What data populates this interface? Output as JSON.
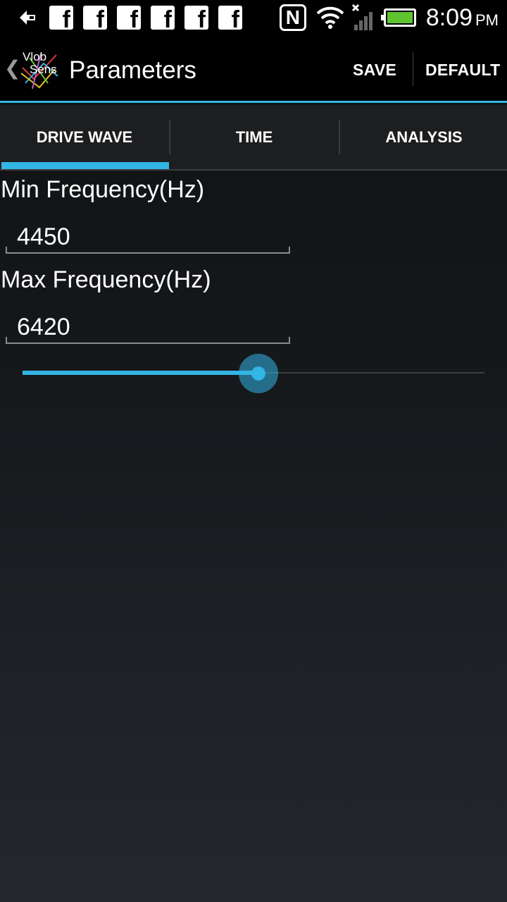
{
  "status_bar": {
    "time": "8:09",
    "ampm": "PM",
    "icons": [
      "usb-debug-icon",
      "facebook-icon",
      "facebook-icon",
      "facebook-icon",
      "facebook-icon",
      "facebook-icon",
      "facebook-icon",
      "nfc-icon",
      "wifi-icon",
      "signal-icon",
      "battery-icon"
    ],
    "facebook_glyph": "f",
    "nfc_glyph": "N",
    "battery_level": 1.0,
    "battery_color": "#5ec52e"
  },
  "action_bar": {
    "back_glyph": "❮",
    "logo_text_top": "Vlob",
    "logo_text_bottom": "Sens",
    "title": "Parameters",
    "save_label": "SAVE",
    "default_label": "DEFAULT"
  },
  "tabs": {
    "items": [
      {
        "label": "DRIVE WAVE",
        "selected": true
      },
      {
        "label": "TIME",
        "selected": false
      },
      {
        "label": "ANALYSIS",
        "selected": false
      }
    ]
  },
  "form": {
    "min_frequency_label": "Min Frequency(Hz)",
    "min_frequency_value": "4450",
    "max_frequency_label": "Max Frequency(Hz)",
    "max_frequency_value": "6420"
  },
  "slider": {
    "value_fraction": 0.51
  },
  "colors": {
    "accent": "#33b5e5",
    "background_top": "#0f1112",
    "background_bottom": "#24282d"
  }
}
